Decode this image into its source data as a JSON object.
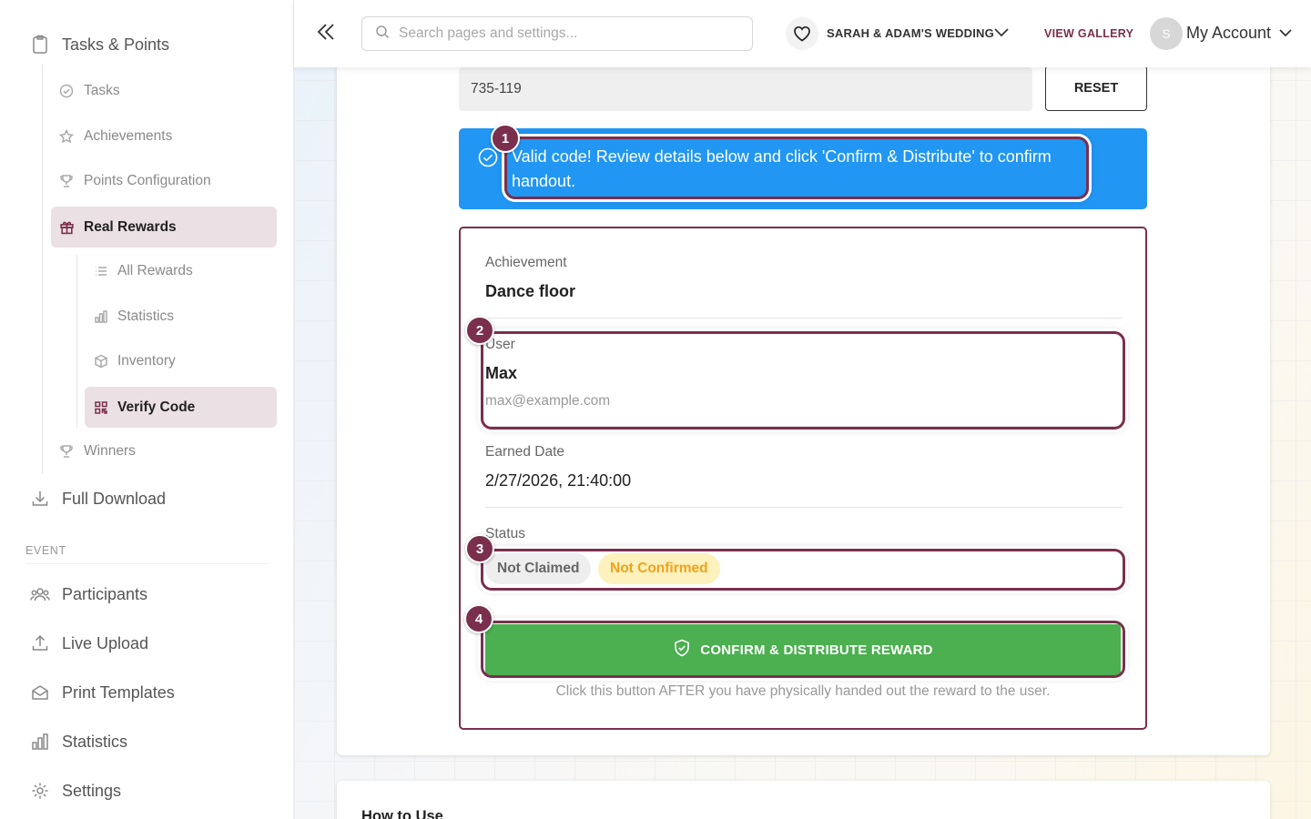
{
  "sidebar": {
    "tasks_points": "Tasks & Points",
    "tasks": "Tasks",
    "achievements": "Achievements",
    "points_configuration": "Points Configuration",
    "real_rewards": "Real Rewards",
    "all_rewards": "All Rewards",
    "statistics_sub": "Statistics",
    "inventory": "Inventory",
    "verify_code": "Verify Code",
    "winners": "Winners",
    "full_download": "Full Download",
    "event_section": "EVENT",
    "participants": "Participants",
    "live_upload": "Live Upload",
    "print_templates": "Print Templates",
    "statistics": "Statistics",
    "settings": "Settings"
  },
  "topbar": {
    "search_placeholder": "Search pages and settings...",
    "event_name": "SARAH & ADAM'S WEDDING",
    "view_gallery": "VIEW GALLERY",
    "avatar_initial": "S",
    "account_label": "My Account"
  },
  "verify": {
    "code_value": "735-119",
    "reset_label": "RESET",
    "alert_text": "Valid code! Review details below and click 'Confirm & Distribute' to confirm handout.",
    "achievement_label": "Achievement",
    "achievement_value": "Dance floor",
    "user_label": "User",
    "user_name": "Max",
    "user_email": "max@example.com",
    "earned_label": "Earned Date",
    "earned_value": "2/27/2026, 21:40:00",
    "status_label": "Status",
    "status_claimed": "Not Claimed",
    "status_confirmed": "Not Confirmed",
    "confirm_label": "CONFIRM & DISTRIBUTE REWARD",
    "helper_text": "Click this button AFTER you have physically handed out the reward to the user."
  },
  "annotations": [
    "1",
    "2",
    "3",
    "4"
  ],
  "how_to_use": {
    "title": "How to Use"
  },
  "colors": {
    "accent": "#7a2f4d",
    "alert_blue": "#2196f3",
    "confirm_green": "#4caf50",
    "active_bg": "#ebe0e4",
    "warning_text": "#f0a31c",
    "warning_bg": "#fdf1bd"
  },
  "icons": {
    "tasks_points": "clipboard-icon",
    "tasks": "check-circle-icon",
    "achievements": "star-icon",
    "points_configuration": "trophy-icon",
    "real_rewards": "gift-icon",
    "all_rewards": "list-icon",
    "statistics_sub": "bar-chart-icon",
    "inventory": "box-icon",
    "verify_code": "qr-code-icon",
    "winners": "trophy-icon",
    "full_download": "download-icon",
    "participants": "people-icon",
    "live_upload": "upload-icon",
    "print_templates": "envelope-icon",
    "statistics": "bar-chart-icon",
    "settings": "gear-icon"
  }
}
